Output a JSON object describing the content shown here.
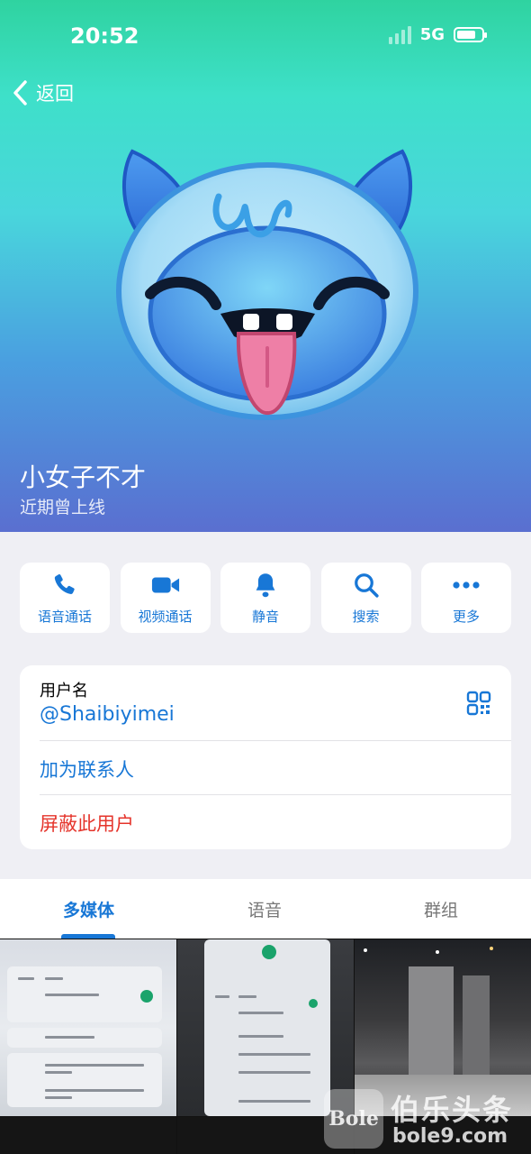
{
  "status_bar": {
    "time": "20:52",
    "network": "5G"
  },
  "nav": {
    "back_label": "返回"
  },
  "profile": {
    "name": "小女子不才",
    "presence": "近期曾上线"
  },
  "actions": [
    {
      "label": "语音通话",
      "icon": "phone-icon"
    },
    {
      "label": "视频通话",
      "icon": "video-camera-icon"
    },
    {
      "label": "静音",
      "icon": "bell-icon"
    },
    {
      "label": "搜索",
      "icon": "search-icon"
    },
    {
      "label": "更多",
      "icon": "more-dots-icon"
    }
  ],
  "info": {
    "username_label": "用户名",
    "username_value": "@Shaibiyimei",
    "add_contact": "加为联系人",
    "block_user": "屏蔽此用户"
  },
  "tabs": [
    {
      "label": "多媒体",
      "active": true
    },
    {
      "label": "语音",
      "active": false
    },
    {
      "label": "群组",
      "active": false
    }
  ],
  "watermark": {
    "logo": "Bole",
    "cn": "伯乐头条",
    "en": "bole9.com"
  },
  "colors": {
    "accent": "#1877d6",
    "danger": "#e5342b",
    "background": "#efeff4"
  }
}
